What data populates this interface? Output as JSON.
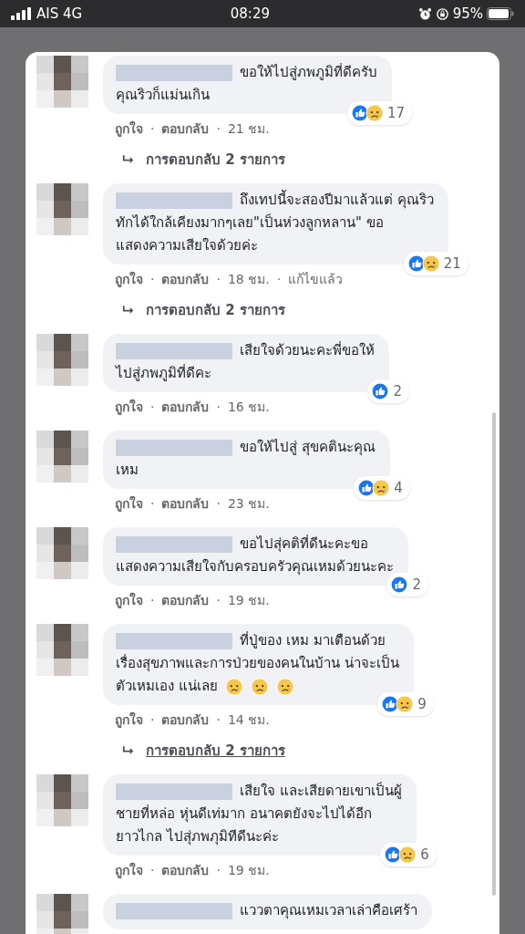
{
  "status_bar": {
    "carrier": "AIS 4G",
    "time": "08:29",
    "battery": "95%"
  },
  "comments": [
    {
      "lines": [
        "ขอให้ไปสู่ภพภูมิที่ดีครับ",
        "คุณริวก็แม่นเกิน"
      ],
      "reactions": [
        {
          "kind": "like"
        },
        {
          "kind": "sad"
        }
      ],
      "reaction_count": "17",
      "meta": [
        {
          "kind": "link",
          "text": "ถูกใจ"
        },
        {
          "kind": "sep",
          "text": "·"
        },
        {
          "kind": "link",
          "text": "ตอบกลับ"
        },
        {
          "kind": "sep",
          "text": "·"
        },
        {
          "kind": "info",
          "text": "21 ชม."
        }
      ],
      "replies": {
        "text": "การตอบกลับ 2 รายการ",
        "underlined": false
      }
    },
    {
      "lines": [
        "ถึงเทปนี้จะสองปีมาแล้วแต่ คุณริว",
        "ทักได้ใกล้เคียงมากๆเลย\"เป็นห่วงลูกหลาน\" ขอ",
        "แสดงความเสียใจด้วยค่ะ"
      ],
      "reactions": [
        {
          "kind": "like"
        },
        {
          "kind": "sad"
        }
      ],
      "reaction_count": "21",
      "meta": [
        {
          "kind": "link",
          "text": "ถูกใจ"
        },
        {
          "kind": "sep",
          "text": "·"
        },
        {
          "kind": "link",
          "text": "ตอบกลับ"
        },
        {
          "kind": "sep",
          "text": "·"
        },
        {
          "kind": "info",
          "text": "18 ชม."
        },
        {
          "kind": "sep",
          "text": "·"
        },
        {
          "kind": "info",
          "text": "แก้ไขแล้ว"
        }
      ],
      "replies": {
        "text": "การตอบกลับ 2 รายการ",
        "underlined": false
      }
    },
    {
      "lines": [
        "เสียใจด้วยนะคะพี่ขอให้",
        "ไปสู่ภพภูมิที่ดีคะ"
      ],
      "reactions": [
        {
          "kind": "like"
        }
      ],
      "reaction_count": "2",
      "meta": [
        {
          "kind": "link",
          "text": "ถูกใจ"
        },
        {
          "kind": "sep",
          "text": "·"
        },
        {
          "kind": "link",
          "text": "ตอบกลับ"
        },
        {
          "kind": "sep",
          "text": "·"
        },
        {
          "kind": "info",
          "text": "16 ชม."
        }
      ]
    },
    {
      "lines": [
        "ขอให้ไปสู่ สุขคตินะคุณ",
        "เหม"
      ],
      "reactions": [
        {
          "kind": "like"
        },
        {
          "kind": "sad"
        }
      ],
      "reaction_count": "4",
      "meta": [
        {
          "kind": "link",
          "text": "ถูกใจ"
        },
        {
          "kind": "sep",
          "text": "·"
        },
        {
          "kind": "link",
          "text": "ตอบกลับ"
        },
        {
          "kind": "sep",
          "text": "·"
        },
        {
          "kind": "info",
          "text": "23 ชม."
        }
      ]
    },
    {
      "lines": [
        "ขอไปสุ่คติที่ดีนะคะขอ",
        "แสดงความเสียใจกับครอบครัวคุณเหมด้วยนะคะ"
      ],
      "reactions": [
        {
          "kind": "like"
        }
      ],
      "reaction_count": "2",
      "meta": [
        {
          "kind": "link",
          "text": "ถูกใจ"
        },
        {
          "kind": "sep",
          "text": "·"
        },
        {
          "kind": "link",
          "text": "ตอบกลับ"
        },
        {
          "kind": "sep",
          "text": "·"
        },
        {
          "kind": "info",
          "text": "19 ชม."
        }
      ]
    },
    {
      "lines": [
        "ที่ปู่ของ เหม มาเตือนด้วย",
        "เรื่องสุขภาพและการป่วยของคนในบ้าน น่าจะเป็น",
        "ตัวเหมเอง แน่เลย"
      ],
      "emojis": [
        {
          "kind": "sad"
        },
        {
          "kind": "sad"
        },
        {
          "kind": "sad"
        }
      ],
      "reactions": [
        {
          "kind": "like"
        },
        {
          "kind": "sad"
        }
      ],
      "reaction_count": "9",
      "meta": [
        {
          "kind": "link",
          "text": "ถูกใจ"
        },
        {
          "kind": "sep",
          "text": "·"
        },
        {
          "kind": "link",
          "text": "ตอบกลับ"
        },
        {
          "kind": "sep",
          "text": "·"
        },
        {
          "kind": "info",
          "text": "14 ชม."
        }
      ],
      "replies": {
        "text": "การตอบกลับ 2 รายการ",
        "underlined": true
      }
    },
    {
      "lines": [
        "เสียใจ และเสียดายเขาเป็นผู้",
        "ชายที่หล่อ หุ่นดีเท่มาก อนาคตยังจะไปได้อีก",
        "ยาวไกล ไปสุ่ภพภุมิทีดีนะค่ะ"
      ],
      "reactions": [
        {
          "kind": "like"
        },
        {
          "kind": "sad"
        }
      ],
      "reaction_count": "6",
      "meta": [
        {
          "kind": "link",
          "text": "ถูกใจ"
        },
        {
          "kind": "sep",
          "text": "·"
        },
        {
          "kind": "link",
          "text": "ตอบกลับ"
        },
        {
          "kind": "sep",
          "text": "·"
        },
        {
          "kind": "info",
          "text": "19 ชม."
        }
      ]
    },
    {
      "lines": [
        "แววตาคุณเหมเวลาเล่าคือเศร้า"
      ]
    }
  ]
}
